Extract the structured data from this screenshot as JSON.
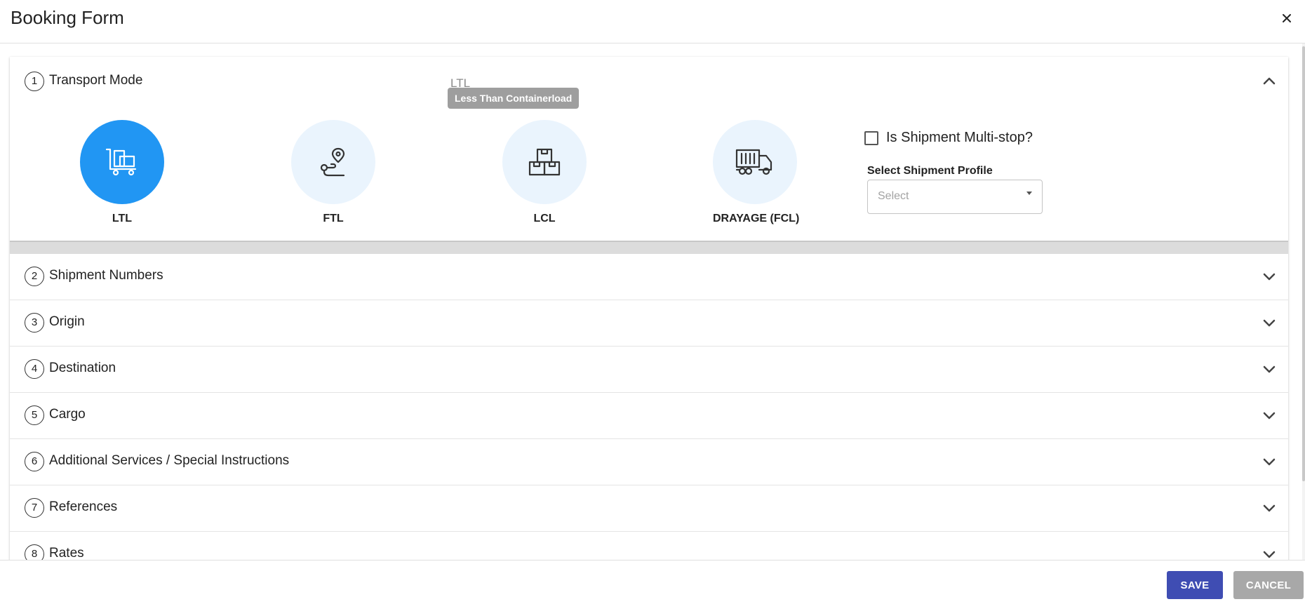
{
  "header": {
    "title": "Booking Form",
    "close_icon": "close-icon"
  },
  "sections": {
    "transport_mode": {
      "number": "1",
      "title": "Transport Mode",
      "expanded": true,
      "tooltip_anchor_text": "LTL",
      "tooltip": "Less Than Containerload",
      "modes": [
        {
          "label": "LTL",
          "icon": "dolly-cart-icon",
          "selected": true
        },
        {
          "label": "FTL",
          "icon": "route-pin-icon",
          "selected": false
        },
        {
          "label": "LCL",
          "icon": "stacked-boxes-icon",
          "selected": false
        },
        {
          "label": "DRAYAGE (FCL)",
          "icon": "container-truck-icon",
          "selected": false
        }
      ],
      "multistop": {
        "label": "Is Shipment Multi-stop?",
        "checked": false
      },
      "profile": {
        "label": "Select Shipment Profile",
        "placeholder": "Select"
      }
    },
    "collapsed": [
      {
        "number": "2",
        "title": "Shipment Numbers"
      },
      {
        "number": "3",
        "title": "Origin"
      },
      {
        "number": "4",
        "title": "Destination"
      },
      {
        "number": "5",
        "title": "Cargo"
      },
      {
        "number": "6",
        "title": "Additional Services / Special Instructions"
      },
      {
        "number": "7",
        "title": "References"
      },
      {
        "number": "8",
        "title": "Rates"
      }
    ]
  },
  "footer": {
    "save_label": "SAVE",
    "cancel_label": "CANCEL"
  },
  "colors": {
    "primary": "#2196f3",
    "mode_bg": "#eaf4fd",
    "save": "#3f4db3",
    "cancel": "#a8a8a8"
  }
}
